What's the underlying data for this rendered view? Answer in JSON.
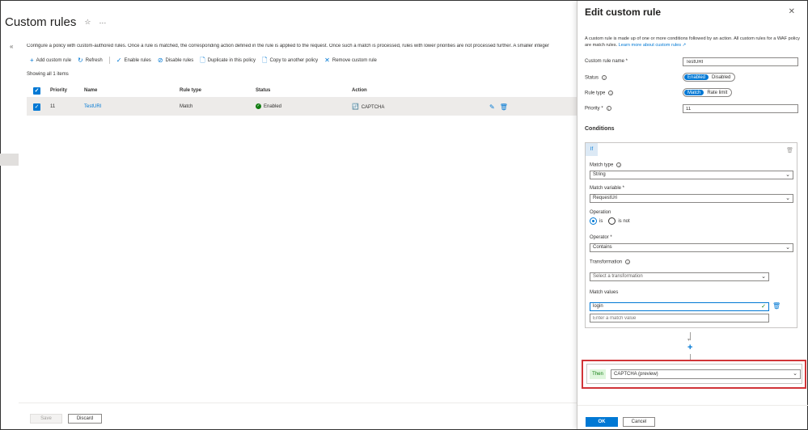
{
  "page": {
    "title": "Custom rules",
    "description": "Configure a policy with custom-authored rules. Once a rule is matched, the corresponding action defined in the rule is applied to the request. Once such a match is processed, rules with lower priorities are not processed further. A smaller integer",
    "showing": "Showing all 1 items"
  },
  "toolbar": {
    "add": "Add custom rule",
    "refresh": "Refresh",
    "enable": "Enable rules",
    "disable": "Disable rules",
    "duplicate": "Duplicate in this policy",
    "copy": "Copy to another policy",
    "remove": "Remove custom rule"
  },
  "table": {
    "headers": {
      "priority": "Priority",
      "name": "Name",
      "rule_type": "Rule type",
      "status": "Status",
      "action": "Action"
    },
    "rows": [
      {
        "priority": "11",
        "name": "TestURI",
        "rule_type": "Match",
        "status": "Enabled",
        "action": "CAPTCHA"
      }
    ]
  },
  "footer": {
    "save": "Save",
    "discard": "Discard"
  },
  "panel": {
    "title": "Edit custom rule",
    "description": "A custom rule is made up of one or more conditions followed by an action. All custom rules for a WAF policy are match rules.",
    "learn_more": "Learn more about custom rules",
    "rule_name_label": "Custom rule name *",
    "rule_name_value": "TestURI",
    "status_label": "Status",
    "status_options": [
      "Enabled",
      "Disabled"
    ],
    "status_selected": "Enabled",
    "rule_type_label": "Rule type",
    "rule_type_options": [
      "Match",
      "Rate limit"
    ],
    "rule_type_selected": "Match",
    "priority_label": "Priority *",
    "priority_value": "11",
    "conditions_title": "Conditions",
    "if_label": "If",
    "match_type_label": "Match type",
    "match_type_value": "String",
    "match_variable_label": "Match variable *",
    "match_variable_value": "RequestUri",
    "operation_label": "Operation",
    "operation_is": "is",
    "operation_is_not": "is not",
    "operator_label": "Operator *",
    "operator_value": "Contains",
    "transformation_label": "Transformation",
    "transformation_placeholder": "Select a transformation",
    "match_values_label": "Match values",
    "match_value_1": "login",
    "match_value_placeholder": "Enter a match value",
    "then_label": "Then",
    "then_value": "CAPTCHA (preview)",
    "ok": "OK",
    "cancel": "Cancel"
  }
}
